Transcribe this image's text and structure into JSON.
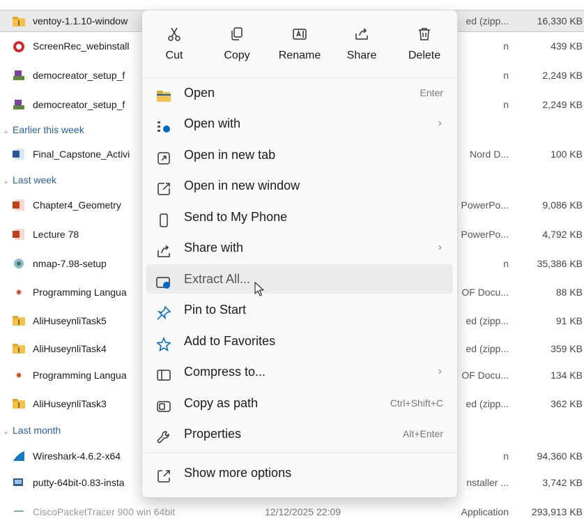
{
  "file_list": {
    "rows": [
      {
        "name": "ventoy-1.1.10-window",
        "date": "",
        "type": "ed (zipp...",
        "size": "16,330 KB",
        "icon": "zip-folder-icon",
        "selected": true
      },
      {
        "name": "ScreenRec_webinstall",
        "date": "",
        "type": "n",
        "size": "439 KB",
        "icon": "app-icon"
      },
      {
        "name": "democreator_setup_f",
        "date": "",
        "type": "n",
        "size": "2,249 KB",
        "icon": "installer-icon"
      },
      {
        "name": "democreator_setup_f",
        "date": "",
        "type": "n",
        "size": "2,249 KB",
        "icon": "installer-icon"
      }
    ],
    "group_earlier": "Earlier this week",
    "rows_earlier": [
      {
        "name": "Final_Capstone_Activi",
        "type": "Nord D...",
        "size": "100 KB",
        "icon": "word-doc-icon"
      }
    ],
    "group_lastweek": "Last week",
    "rows_lastweek": [
      {
        "name": "Chapter4_Geometry",
        "type": "PowerPo...",
        "size": "9,086 KB",
        "icon": "powerpoint-icon"
      },
      {
        "name": "Lecture 78",
        "type": "PowerPo...",
        "size": "4,792 KB",
        "icon": "powerpoint-icon"
      },
      {
        "name": "nmap-7.98-setup",
        "type": "n",
        "size": "35,386 KB",
        "icon": "installer-icon"
      },
      {
        "name": "Programming Langua",
        "type": "OF Docu...",
        "size": "88 KB",
        "icon": "pdf-icon"
      },
      {
        "name": "AliHuseynliTask5",
        "type": "ed (zipp...",
        "size": "91 KB",
        "icon": "zip-folder-icon"
      },
      {
        "name": "AliHuseynliTask4",
        "type": "ed (zipp...",
        "size": "359 KB",
        "icon": "zip-folder-icon"
      },
      {
        "name": "Programming Langua",
        "type": "OF Docu...",
        "size": "134 KB",
        "icon": "pdf-icon"
      },
      {
        "name": "AliHuseynliTask3",
        "type": "ed (zipp...",
        "size": "362 KB",
        "icon": "zip-folder-icon"
      }
    ],
    "group_lastmonth": "Last month",
    "rows_lastmonth": [
      {
        "name": "Wireshark-4.6.2-x64",
        "type": "n",
        "size": "94,360 KB",
        "icon": "wireshark-icon"
      },
      {
        "name": "putty-64bit-0.83-insta",
        "type": "nstaller ...",
        "size": "3,742 KB",
        "icon": "installer-icon"
      },
      {
        "name": "CiscoPacketTracer 900 win 64bit",
        "date": "12/12/2025 22:09",
        "type": "Application",
        "size": "293,913 KB",
        "icon": "app-icon"
      }
    ]
  },
  "context_menu": {
    "quick_actions": [
      {
        "label": "Cut",
        "icon": "scissors-icon"
      },
      {
        "label": "Copy",
        "icon": "copy-icon"
      },
      {
        "label": "Rename",
        "icon": "rename-icon"
      },
      {
        "label": "Share",
        "icon": "share-icon"
      },
      {
        "label": "Delete",
        "icon": "trash-icon"
      }
    ],
    "items": [
      {
        "label": "Open",
        "shortcut": "Enter",
        "icon": "folder-icon"
      },
      {
        "label": "Open with",
        "submenu": true,
        "icon": "open-with-icon"
      },
      {
        "label": "Open in new tab",
        "icon": "new-tab-icon"
      },
      {
        "label": "Open in new window",
        "icon": "new-window-icon"
      },
      {
        "label": "Send to My Phone",
        "icon": "phone-icon"
      },
      {
        "label": "Share with",
        "submenu": true,
        "icon": "share-with-icon"
      },
      {
        "label": "Extract All...",
        "icon": "extract-icon",
        "hovered": true
      },
      {
        "label": "Pin to Start",
        "icon": "pin-icon"
      },
      {
        "label": "Add to Favorites",
        "icon": "star-icon"
      },
      {
        "label": "Compress to...",
        "submenu": true,
        "icon": "compress-icon"
      },
      {
        "label": "Copy as path",
        "shortcut": "Ctrl+Shift+C",
        "icon": "copy-path-icon"
      },
      {
        "label": "Properties",
        "shortcut": "Alt+Enter",
        "icon": "wrench-icon"
      },
      {
        "label": "Show more options",
        "icon": "more-options-icon"
      }
    ],
    "submenu_arrow": "›",
    "colors": {
      "accent": "#0067c0",
      "folder": "#f2c14e"
    }
  },
  "group_chevron": "⌄"
}
